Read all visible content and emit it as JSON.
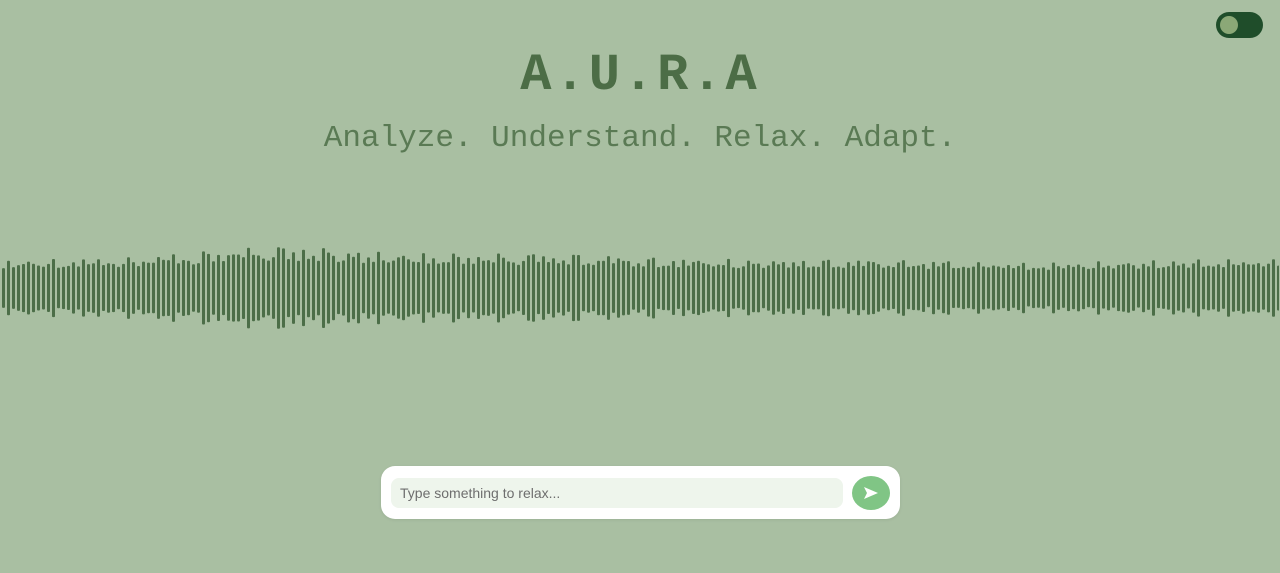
{
  "header": {
    "title": "A.U.R.A",
    "tagline": "Analyze. Understand. Relax. Adapt."
  },
  "theme_toggle": {
    "state": "on",
    "icon": "toggle-switch"
  },
  "waveform": {
    "icon": "audio-waveform",
    "color": "#4c6e48"
  },
  "chat": {
    "input_value": "",
    "placeholder": "Type something to relax...",
    "send_icon": "send-arrow-icon",
    "send_color": "#80c585"
  },
  "colors": {
    "background": "#a9bfa2",
    "title": "#4c6d46",
    "toggle_track": "#1f4d2a",
    "toggle_knob": "#8ba877"
  }
}
